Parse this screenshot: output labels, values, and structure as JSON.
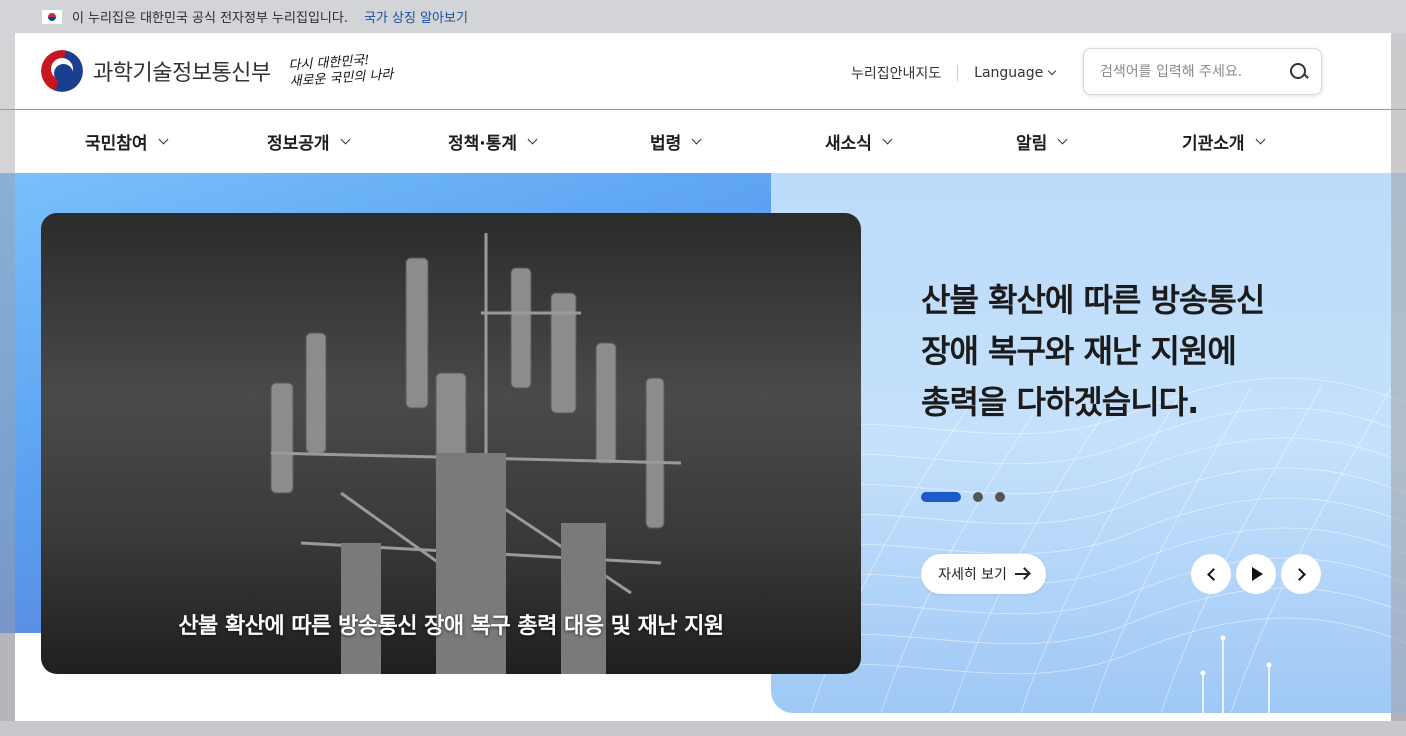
{
  "gov_banner": {
    "text": "이 누리집은 대한민국 공식 전자정부 누리집입니다.",
    "link": "국가 상징 알아보기"
  },
  "header": {
    "ministry_name": "과학기술정보통신부",
    "slogan_line1": "다시 대한민국!",
    "slogan_line2": "새로운 국민의 나라",
    "sitemap_label": "누리집안내지도",
    "language_label": "Language",
    "search_placeholder": "검색어를 입력해 주세요."
  },
  "nav": {
    "items": [
      {
        "label": "국민참여"
      },
      {
        "label": "정보공개"
      },
      {
        "label": "정책·통계"
      },
      {
        "label": "법령"
      },
      {
        "label": "새소식"
      },
      {
        "label": "알림"
      },
      {
        "label": "기관소개"
      }
    ]
  },
  "hero": {
    "image_caption": "산불 확산에 따른 방송통신 장애 복구 총력 대응 및 재난 지원",
    "title_lines": [
      "산불 확산에 따른 방송통신",
      "장애 복구와 재난 지원에",
      "총력을 다하겠습니다."
    ],
    "detail_button": "자세히 보기",
    "slide_count": 3,
    "active_slide": 1,
    "colors": {
      "accent": "#1f5ac9",
      "left_bg": "#6fb3f7",
      "right_bg": "#c2dffb"
    }
  }
}
